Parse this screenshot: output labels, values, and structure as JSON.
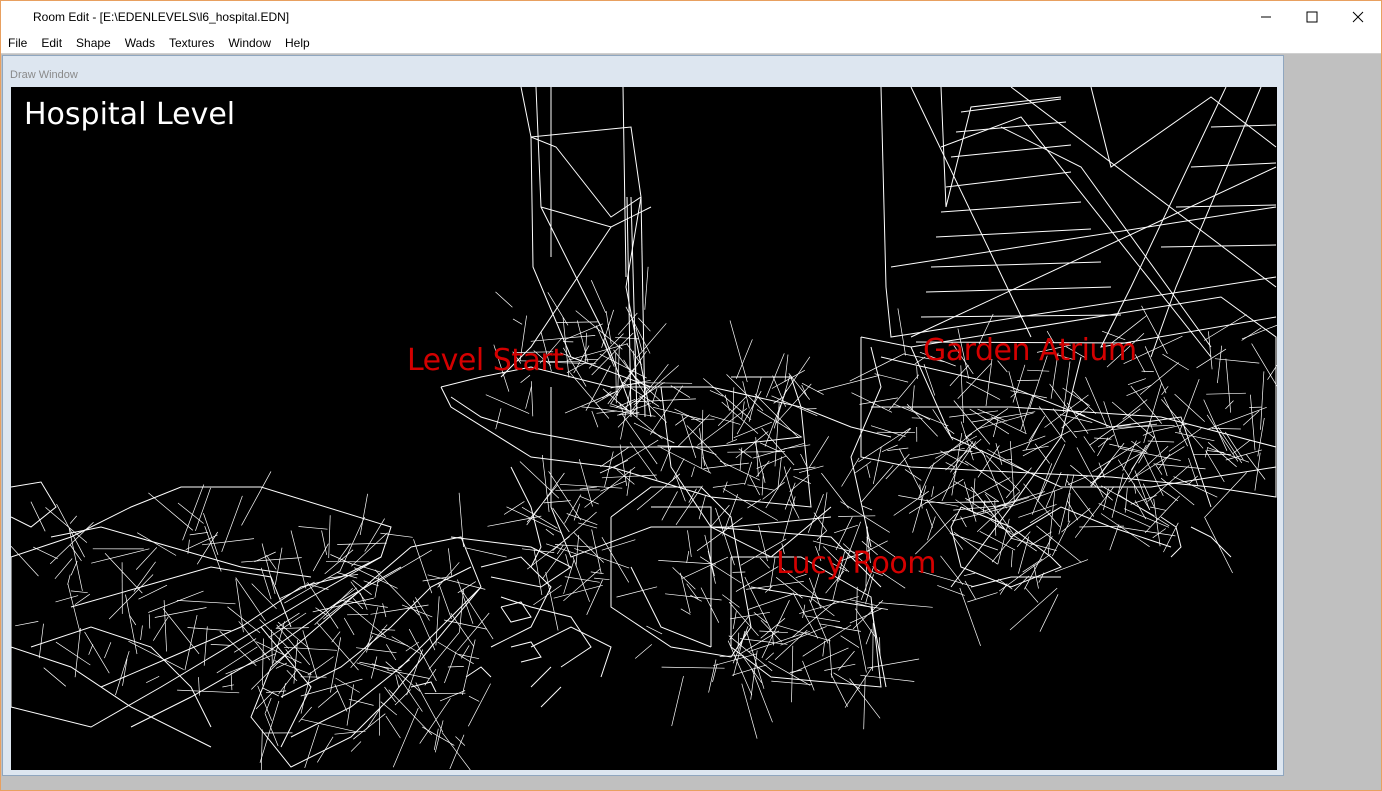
{
  "window": {
    "title": "Room Edit - [E:\\EDENLEVELS\\l6_hospital.EDN]"
  },
  "menubar": {
    "items": [
      "File",
      "Edit",
      "Shape",
      "Wads",
      "Textures",
      "Window",
      "Help"
    ]
  },
  "draw_window": {
    "caption": "Draw Window",
    "overlay_title": "Hospital Level",
    "labels": {
      "level_start": "Level Start",
      "garden_atrium": "Garden Atrium",
      "lucy_room": "Lucy Room"
    },
    "label_color": "#d40000"
  },
  "icons": [
    "app-icon",
    "minimize-icon",
    "maximize-icon",
    "close-icon"
  ]
}
